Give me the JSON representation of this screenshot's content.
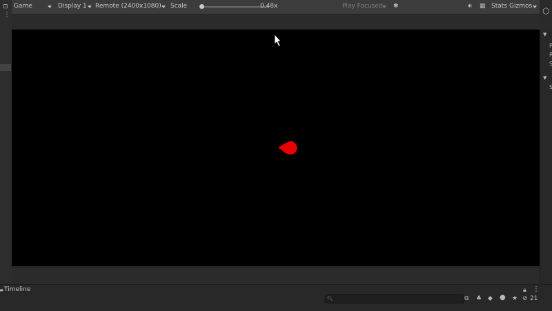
{
  "toolbar": {
    "view_tab": "Game",
    "display": "Display 1",
    "resolution": "Remote (2400x1080)",
    "scale_label": "Scale",
    "scale_value": "0.48x",
    "play_mode": "Play Focused",
    "stats_label": "Stats",
    "gizmos_label": "Gizmos"
  },
  "game_view": {
    "player_blob_color": "#e80000",
    "background_color": "#000000"
  },
  "timeline": {
    "title": "Timeline",
    "search_placeholder": "",
    "hidden_count": "21"
  },
  "icons": {
    "more": "more-vertical-icon",
    "audio": "speaker-icon",
    "settings": "gear-icon",
    "lock": "lock-icon",
    "menu": "kebab-menu-icon",
    "cube": "cube-icon"
  }
}
